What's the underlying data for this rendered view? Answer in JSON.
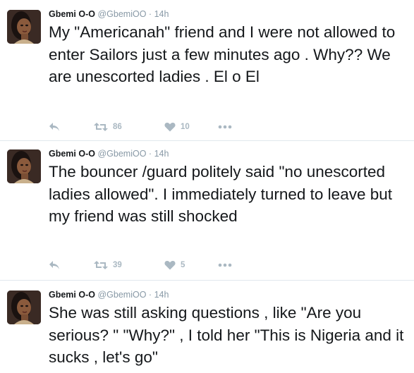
{
  "tweets": [
    {
      "name": "Gbemi O-O",
      "handle": "@GbemiOO",
      "separator": "·",
      "time": "14h",
      "text": "My \"Americanah\" friend and I were not allowed to enter Sailors just a few minutes ago . Why?? We are unescorted ladies . El o El",
      "retweets": "86",
      "likes": "10"
    },
    {
      "name": "Gbemi O-O",
      "handle": "@GbemiOO",
      "separator": "·",
      "time": "14h",
      "text": "The bouncer /guard politely said \"no unescorted ladies allowed\". I immediately turned to leave but my friend was still shocked",
      "retweets": "39",
      "likes": "5"
    },
    {
      "name": "Gbemi O-O",
      "handle": "@GbemiOO",
      "separator": "·",
      "time": "14h",
      "text": "She was still asking questions , like \"Are you serious? \" \"Why?\" , I told her \"This is Nigeria and it sucks , let's go\""
    }
  ],
  "icons": {
    "reply": "reply-icon",
    "retweet": "retweet-icon",
    "like": "heart-icon",
    "more": "more-icon"
  },
  "colors": {
    "name": "#14171a",
    "meta": "#8899a6",
    "action_icon": "#aab8c2",
    "divider": "#e1e8ed"
  }
}
